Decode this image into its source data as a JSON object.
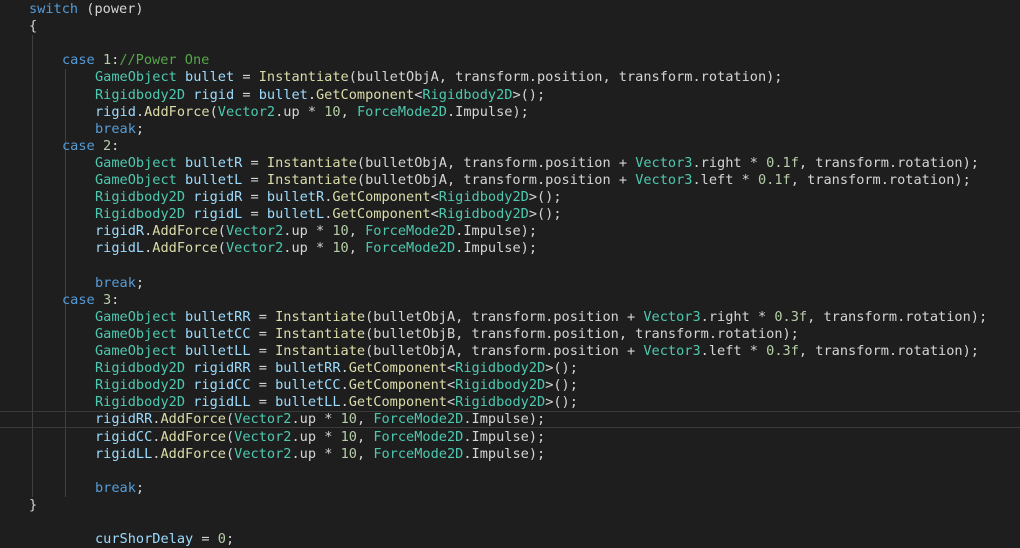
{
  "editor": {
    "colors": {
      "background": "#1e1e1e",
      "keyword": "#569cd6",
      "type": "#4ec9b0",
      "variable": "#9cdcfe",
      "function": "#dcdcaa",
      "number": "#b5cea8",
      "comment": "#57a64a",
      "text": "#d4d4d4"
    },
    "current_line": 24,
    "lines": [
      {
        "indent": 1,
        "tokens": [
          [
            "kw",
            "switch"
          ],
          [
            "txt",
            " (power)"
          ]
        ]
      },
      {
        "indent": 1,
        "tokens": [
          [
            "txt",
            "{"
          ]
        ]
      },
      {
        "indent": 0,
        "tokens": []
      },
      {
        "indent": 2,
        "tokens": [
          [
            "kw",
            "case"
          ],
          [
            "txt",
            " "
          ],
          [
            "num",
            "1"
          ],
          [
            "txt",
            ":"
          ],
          [
            "cmt",
            "//Power One"
          ]
        ]
      },
      {
        "indent": 3,
        "tokens": [
          [
            "type",
            "GameObject"
          ],
          [
            "txt",
            " "
          ],
          [
            "var",
            "bullet"
          ],
          [
            "txt",
            " = "
          ],
          [
            "fn",
            "Instantiate"
          ],
          [
            "txt",
            "(bulletObjA, transform.position, transform.rotation);"
          ]
        ]
      },
      {
        "indent": 3,
        "tokens": [
          [
            "type",
            "Rigidbody2D"
          ],
          [
            "txt",
            " "
          ],
          [
            "var",
            "rigid"
          ],
          [
            "txt",
            " = "
          ],
          [
            "var",
            "bullet"
          ],
          [
            "txt",
            "."
          ],
          [
            "fn",
            "GetComponent"
          ],
          [
            "txt",
            "<"
          ],
          [
            "type",
            "Rigidbody2D"
          ],
          [
            "txt",
            ">();"
          ]
        ]
      },
      {
        "indent": 3,
        "tokens": [
          [
            "var",
            "rigid"
          ],
          [
            "txt",
            "."
          ],
          [
            "fn",
            "AddForce"
          ],
          [
            "txt",
            "("
          ],
          [
            "type",
            "Vector2"
          ],
          [
            "txt",
            ".up * "
          ],
          [
            "num",
            "10"
          ],
          [
            "txt",
            ", "
          ],
          [
            "type",
            "ForceMode2D"
          ],
          [
            "txt",
            ".Impulse);"
          ]
        ]
      },
      {
        "indent": 3,
        "tokens": [
          [
            "kw",
            "break"
          ],
          [
            "txt",
            ";"
          ]
        ]
      },
      {
        "indent": 2,
        "tokens": [
          [
            "kw",
            "case"
          ],
          [
            "txt",
            " "
          ],
          [
            "num",
            "2"
          ],
          [
            "txt",
            ":"
          ]
        ]
      },
      {
        "indent": 3,
        "tokens": [
          [
            "type",
            "GameObject"
          ],
          [
            "txt",
            " "
          ],
          [
            "var",
            "bulletR"
          ],
          [
            "txt",
            " = "
          ],
          [
            "fn",
            "Instantiate"
          ],
          [
            "txt",
            "(bulletObjA, transform.position + "
          ],
          [
            "type",
            "Vector3"
          ],
          [
            "txt",
            ".right * "
          ],
          [
            "num",
            "0.1f"
          ],
          [
            "txt",
            ", transform.rotation);"
          ]
        ]
      },
      {
        "indent": 3,
        "tokens": [
          [
            "type",
            "GameObject"
          ],
          [
            "txt",
            " "
          ],
          [
            "var",
            "bulletL"
          ],
          [
            "txt",
            " = "
          ],
          [
            "fn",
            "Instantiate"
          ],
          [
            "txt",
            "(bulletObjA, transform.position + "
          ],
          [
            "type",
            "Vector3"
          ],
          [
            "txt",
            ".left * "
          ],
          [
            "num",
            "0.1f"
          ],
          [
            "txt",
            ", transform.rotation);"
          ]
        ]
      },
      {
        "indent": 3,
        "tokens": [
          [
            "type",
            "Rigidbody2D"
          ],
          [
            "txt",
            " "
          ],
          [
            "var",
            "rigidR"
          ],
          [
            "txt",
            " = "
          ],
          [
            "var",
            "bulletR"
          ],
          [
            "txt",
            "."
          ],
          [
            "fn",
            "GetComponent"
          ],
          [
            "txt",
            "<"
          ],
          [
            "type",
            "Rigidbody2D"
          ],
          [
            "txt",
            ">();"
          ]
        ]
      },
      {
        "indent": 3,
        "tokens": [
          [
            "type",
            "Rigidbody2D"
          ],
          [
            "txt",
            " "
          ],
          [
            "var",
            "rigidL"
          ],
          [
            "txt",
            " = "
          ],
          [
            "var",
            "bulletL"
          ],
          [
            "txt",
            "."
          ],
          [
            "fn",
            "GetComponent"
          ],
          [
            "txt",
            "<"
          ],
          [
            "type",
            "Rigidbody2D"
          ],
          [
            "txt",
            ">();"
          ]
        ]
      },
      {
        "indent": 3,
        "tokens": [
          [
            "var",
            "rigidR"
          ],
          [
            "txt",
            "."
          ],
          [
            "fn",
            "AddForce"
          ],
          [
            "txt",
            "("
          ],
          [
            "type",
            "Vector2"
          ],
          [
            "txt",
            ".up * "
          ],
          [
            "num",
            "10"
          ],
          [
            "txt",
            ", "
          ],
          [
            "type",
            "ForceMode2D"
          ],
          [
            "txt",
            ".Impulse);"
          ]
        ]
      },
      {
        "indent": 3,
        "tokens": [
          [
            "var",
            "rigidL"
          ],
          [
            "txt",
            "."
          ],
          [
            "fn",
            "AddForce"
          ],
          [
            "txt",
            "("
          ],
          [
            "type",
            "Vector2"
          ],
          [
            "txt",
            ".up * "
          ],
          [
            "num",
            "10"
          ],
          [
            "txt",
            ", "
          ],
          [
            "type",
            "ForceMode2D"
          ],
          [
            "txt",
            ".Impulse);"
          ]
        ]
      },
      {
        "indent": 0,
        "tokens": []
      },
      {
        "indent": 3,
        "tokens": [
          [
            "kw",
            "break"
          ],
          [
            "txt",
            ";"
          ]
        ]
      },
      {
        "indent": 2,
        "tokens": [
          [
            "kw",
            "case"
          ],
          [
            "txt",
            " "
          ],
          [
            "num",
            "3"
          ],
          [
            "txt",
            ":"
          ]
        ]
      },
      {
        "indent": 3,
        "tokens": [
          [
            "type",
            "GameObject"
          ],
          [
            "txt",
            " "
          ],
          [
            "var",
            "bulletRR"
          ],
          [
            "txt",
            " = "
          ],
          [
            "fn",
            "Instantiate"
          ],
          [
            "txt",
            "(bulletObjA, transform.position + "
          ],
          [
            "type",
            "Vector3"
          ],
          [
            "txt",
            ".right * "
          ],
          [
            "num",
            "0.3f"
          ],
          [
            "txt",
            ", transform.rotation);"
          ]
        ]
      },
      {
        "indent": 3,
        "tokens": [
          [
            "type",
            "GameObject"
          ],
          [
            "txt",
            " "
          ],
          [
            "var",
            "bulletCC"
          ],
          [
            "txt",
            " = "
          ],
          [
            "fn",
            "Instantiate"
          ],
          [
            "txt",
            "(bulletObjB, transform.position, transform.rotation);"
          ]
        ]
      },
      {
        "indent": 3,
        "tokens": [
          [
            "type",
            "GameObject"
          ],
          [
            "txt",
            " "
          ],
          [
            "var",
            "bulletLL"
          ],
          [
            "txt",
            " = "
          ],
          [
            "fn",
            "Instantiate"
          ],
          [
            "txt",
            "(bulletObjA, transform.position + "
          ],
          [
            "type",
            "Vector3"
          ],
          [
            "txt",
            ".left * "
          ],
          [
            "num",
            "0.3f"
          ],
          [
            "txt",
            ", transform.rotation);"
          ]
        ]
      },
      {
        "indent": 3,
        "tokens": [
          [
            "type",
            "Rigidbody2D"
          ],
          [
            "txt",
            " "
          ],
          [
            "var",
            "rigidRR"
          ],
          [
            "txt",
            " = "
          ],
          [
            "var",
            "bulletRR"
          ],
          [
            "txt",
            "."
          ],
          [
            "fn",
            "GetComponent"
          ],
          [
            "txt",
            "<"
          ],
          [
            "type",
            "Rigidbody2D"
          ],
          [
            "txt",
            ">();"
          ]
        ]
      },
      {
        "indent": 3,
        "tokens": [
          [
            "type",
            "Rigidbody2D"
          ],
          [
            "txt",
            " "
          ],
          [
            "var",
            "rigidCC"
          ],
          [
            "txt",
            " = "
          ],
          [
            "var",
            "bulletCC"
          ],
          [
            "txt",
            "."
          ],
          [
            "fn",
            "GetComponent"
          ],
          [
            "txt",
            "<"
          ],
          [
            "type",
            "Rigidbody2D"
          ],
          [
            "txt",
            ">();"
          ]
        ]
      },
      {
        "indent": 3,
        "tokens": [
          [
            "type",
            "Rigidbody2D"
          ],
          [
            "txt",
            " "
          ],
          [
            "var",
            "rigidLL"
          ],
          [
            "txt",
            " = "
          ],
          [
            "var",
            "bulletLL"
          ],
          [
            "txt",
            "."
          ],
          [
            "fn",
            "GetComponent"
          ],
          [
            "txt",
            "<"
          ],
          [
            "type",
            "Rigidbody2D"
          ],
          [
            "txt",
            ">();"
          ]
        ]
      },
      {
        "indent": 3,
        "tokens": [
          [
            "var",
            "rigidRR"
          ],
          [
            "txt",
            "."
          ],
          [
            "fn",
            "AddForce"
          ],
          [
            "txt",
            "("
          ],
          [
            "type",
            "Vector2"
          ],
          [
            "txt",
            ".up * "
          ],
          [
            "num",
            "10"
          ],
          [
            "txt",
            ", "
          ],
          [
            "type",
            "ForceMode2D"
          ],
          [
            "txt",
            ".Impulse);"
          ]
        ]
      },
      {
        "indent": 3,
        "tokens": [
          [
            "var",
            "rigidCC"
          ],
          [
            "txt",
            "."
          ],
          [
            "fn",
            "AddForce"
          ],
          [
            "txt",
            "("
          ],
          [
            "type",
            "Vector2"
          ],
          [
            "txt",
            ".up * "
          ],
          [
            "num",
            "10"
          ],
          [
            "txt",
            ", "
          ],
          [
            "type",
            "ForceMode2D"
          ],
          [
            "txt",
            ".Impulse);"
          ]
        ]
      },
      {
        "indent": 3,
        "tokens": [
          [
            "var",
            "rigidLL"
          ],
          [
            "txt",
            "."
          ],
          [
            "fn",
            "AddForce"
          ],
          [
            "txt",
            "("
          ],
          [
            "type",
            "Vector2"
          ],
          [
            "txt",
            ".up * "
          ],
          [
            "num",
            "10"
          ],
          [
            "txt",
            ", "
          ],
          [
            "type",
            "ForceMode2D"
          ],
          [
            "txt",
            ".Impulse);"
          ]
        ]
      },
      {
        "indent": 0,
        "tokens": []
      },
      {
        "indent": 3,
        "tokens": [
          [
            "kw",
            "break"
          ],
          [
            "txt",
            ";"
          ]
        ]
      },
      {
        "indent": 1,
        "tokens": [
          [
            "txt",
            "}"
          ]
        ]
      },
      {
        "indent": 0,
        "tokens": []
      },
      {
        "indent": 3,
        "tokens": [
          [
            "var",
            "curShorDelay"
          ],
          [
            "txt",
            " = "
          ],
          [
            "num",
            "0"
          ],
          [
            "txt",
            ";"
          ]
        ]
      }
    ]
  }
}
